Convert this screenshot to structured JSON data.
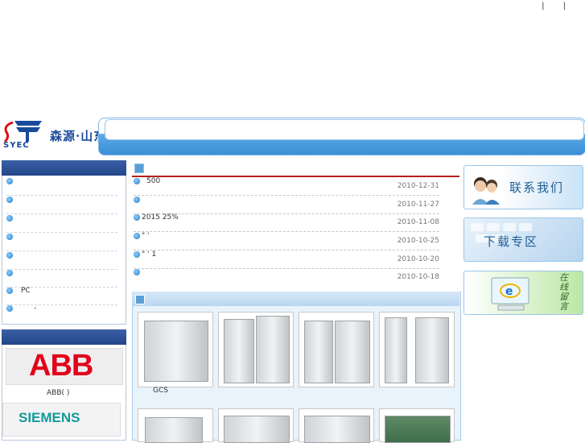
{
  "header": {
    "top_links": "| |",
    "logo_text": "森源·山东",
    "logo_abbr": "SYEC"
  },
  "sidebar": {
    "items": [
      {
        "label": ""
      },
      {
        "label": ""
      },
      {
        "label": ""
      },
      {
        "label": ""
      },
      {
        "label": ""
      },
      {
        "label": ""
      },
      {
        "label": "PC"
      },
      {
        "label": "-"
      }
    ]
  },
  "brands": {
    "abb_logo": "ABB",
    "abb_caption": "ABB( )",
    "siemens_logo": "SIEMENS"
  },
  "news": {
    "rows": [
      {
        "title": "500",
        "date": "2010-12-31"
      },
      {
        "title": "",
        "date": "2010-11-27"
      },
      {
        "title": "2015        25%",
        "date": "2010-11-08"
      },
      {
        "title": "\"  '",
        "date": "2010-10-25"
      },
      {
        "title": "\"  '      1",
        "date": "2010-10-20"
      },
      {
        "title": "",
        "date": "2010-10-18"
      }
    ]
  },
  "products": {
    "caption": "GCS"
  },
  "right_panel": {
    "contact_label": "联系我们",
    "download_label": "下载专区",
    "message_label": "在线留言"
  },
  "colors": {
    "accent_blue": "#23468a",
    "news_rule": "#b3201f",
    "nav_blue": "#3b8ed6"
  }
}
